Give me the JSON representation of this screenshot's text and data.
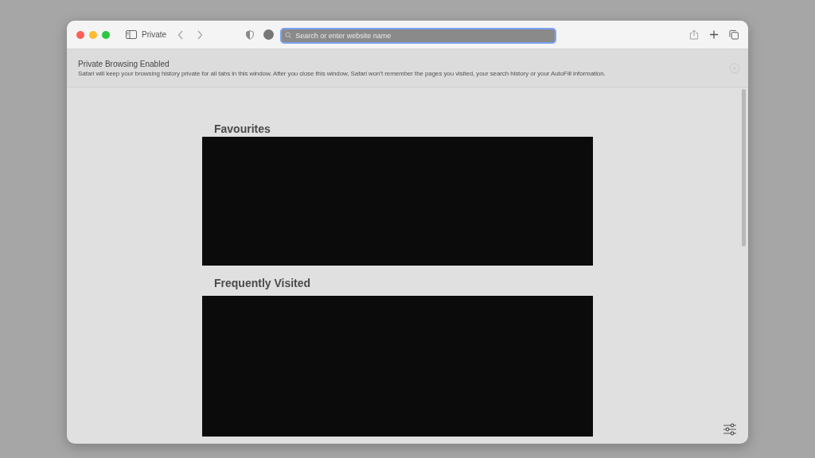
{
  "toolbar": {
    "mode_label": "Private",
    "address_field": {
      "placeholder": "Search or enter website name"
    }
  },
  "banner": {
    "title": "Private Browsing Enabled",
    "message": "Safari will keep your browsing history private for all tabs in this window. After you close this window, Safari won’t remember the pages you visited, your search history or your AutoFill information."
  },
  "sections": [
    {
      "heading": "Favourites",
      "kind": "short"
    },
    {
      "heading": "Frequently Visited",
      "kind": "tall"
    }
  ]
}
